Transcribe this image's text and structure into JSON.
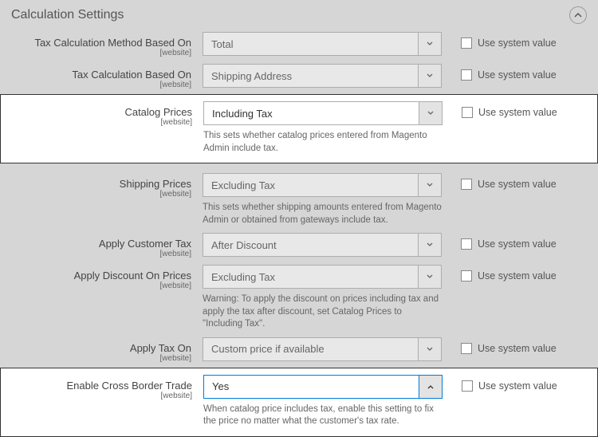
{
  "section_title": "Calculation Settings",
  "scope_label": "[website]",
  "use_system_label": "Use system value",
  "fields": {
    "calc_method": {
      "label": "Tax Calculation Method Based On",
      "value": "Total"
    },
    "calc_based_on": {
      "label": "Tax Calculation Based On",
      "value": "Shipping Address"
    },
    "catalog_prices": {
      "label": "Catalog Prices",
      "value": "Including Tax",
      "help": "This sets whether catalog prices entered from Magento Admin include tax."
    },
    "shipping_prices": {
      "label": "Shipping Prices",
      "value": "Excluding Tax",
      "help": "This sets whether shipping amounts entered from Magento Admin or obtained from gateways include tax."
    },
    "apply_customer_tax": {
      "label": "Apply Customer Tax",
      "value": "After Discount"
    },
    "apply_discount": {
      "label": "Apply Discount On Prices",
      "value": "Excluding Tax",
      "help": "Warning: To apply the discount on prices including tax and apply the tax after discount, set Catalog Prices to \"Including Tax\"."
    },
    "apply_tax_on": {
      "label": "Apply Tax On",
      "value": "Custom price if available"
    },
    "cross_border": {
      "label": "Enable Cross Border Trade",
      "value": "Yes",
      "help": "When catalog price includes tax, enable this setting to fix the price no matter what the customer's tax rate."
    }
  }
}
